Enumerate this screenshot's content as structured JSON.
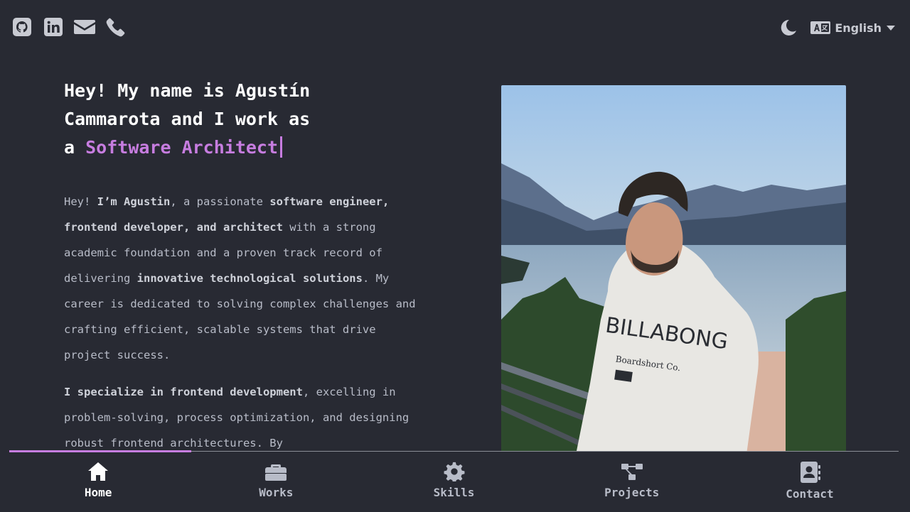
{
  "header": {
    "social_icons": [
      "github-icon",
      "linkedin-icon",
      "mail-icon",
      "phone-icon"
    ],
    "theme_icon": "moon-icon",
    "language": "English"
  },
  "hero": {
    "title_line1": "Hey! My name is Agustín",
    "title_line2": "Cammarota and I work as",
    "title_prefix": "a ",
    "role": "Software Architect"
  },
  "bio": {
    "p1": [
      {
        "t": "Hey! ",
        "b": false
      },
      {
        "t": "I’m Agustin",
        "b": true
      },
      {
        "t": ", a passionate ",
        "b": false
      },
      {
        "t": "software engineer, frontend developer, and architect",
        "b": true
      },
      {
        "t": " with a strong academic foundation and a proven track record of delivering ",
        "b": false
      },
      {
        "t": "innovative technological solutions",
        "b": true
      },
      {
        "t": ". My career is dedicated to solving complex challenges and crafting efficient, scalable systems that drive project success.",
        "b": false
      }
    ],
    "p2": [
      {
        "t": "I specialize in frontend development",
        "b": true
      },
      {
        "t": ", excelling in problem-solving, process optimization, and designing robust frontend architectures. By",
        "b": false
      }
    ]
  },
  "nav": {
    "items": [
      {
        "label": "Home",
        "icon": "home-icon",
        "active": true
      },
      {
        "label": "Works",
        "icon": "briefcase-icon",
        "active": false
      },
      {
        "label": "Skills",
        "icon": "gear-icon",
        "active": false
      },
      {
        "label": "Projects",
        "icon": "diagram-icon",
        "active": false
      },
      {
        "label": "Contact",
        "icon": "contact-card-icon",
        "active": false
      }
    ]
  },
  "colors": {
    "accent": "#c77de0",
    "background": "#282a33",
    "text": "#b8bcc8"
  }
}
